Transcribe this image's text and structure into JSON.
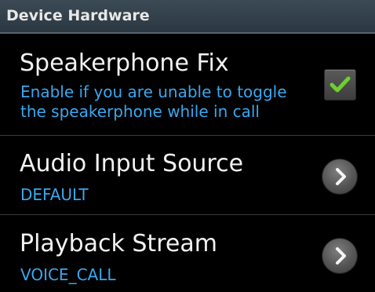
{
  "section": {
    "title": "Device Hardware"
  },
  "preferences": [
    {
      "title": "Speakerphone Fix",
      "summary_lines": [
        "Enable if you are unable to toggle",
        "the speakerphone while in call"
      ],
      "widget": "checkbox",
      "checked": true
    },
    {
      "title": "Audio Input Source",
      "summary": "DEFAULT",
      "widget": "chevron-right-icon"
    },
    {
      "title": "Playback Stream",
      "summary": "VOICE_CALL",
      "widget": "chevron-right-icon"
    }
  ],
  "colors": {
    "background": "#000000",
    "header_background": "#34434e",
    "summary_text": "#3aa7f0",
    "check_mark": "#6cd12c"
  }
}
